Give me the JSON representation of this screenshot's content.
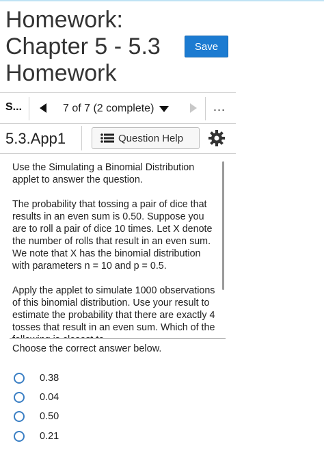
{
  "header": {
    "title": "Homework: Chapter 5 - 5.3 Homework",
    "save_label": "Save"
  },
  "nav": {
    "short_label": "S...",
    "progress": "7 of 7 (2 complete)",
    "more": "..."
  },
  "question": {
    "id": "5.3.App1",
    "help_label": "Question Help",
    "paragraphs": [
      "Use the Simulating a Binomial Distribution applet to answer the question.",
      "The probability that tossing a pair of dice that results in an even sum is 0.50. Suppose you are to roll a pair of dice 10 times. Let X denote the number of rolls that result in an even sum. We note that X has the binomial distribution with parameters n = 10 and p = 0.5.",
      "Apply the applet to simulate 1000 observations of this binomial distribution. Use your result to estimate the probability that there are exactly 4 tosses that result in an even sum. Which of the following is closest to"
    ],
    "instruction": "Choose the correct answer below.",
    "options": [
      "0.38",
      "0.04",
      "0.50",
      "0.21"
    ]
  },
  "colors": {
    "accent": "#1c7bd1",
    "radio": "#3b7fc4"
  }
}
